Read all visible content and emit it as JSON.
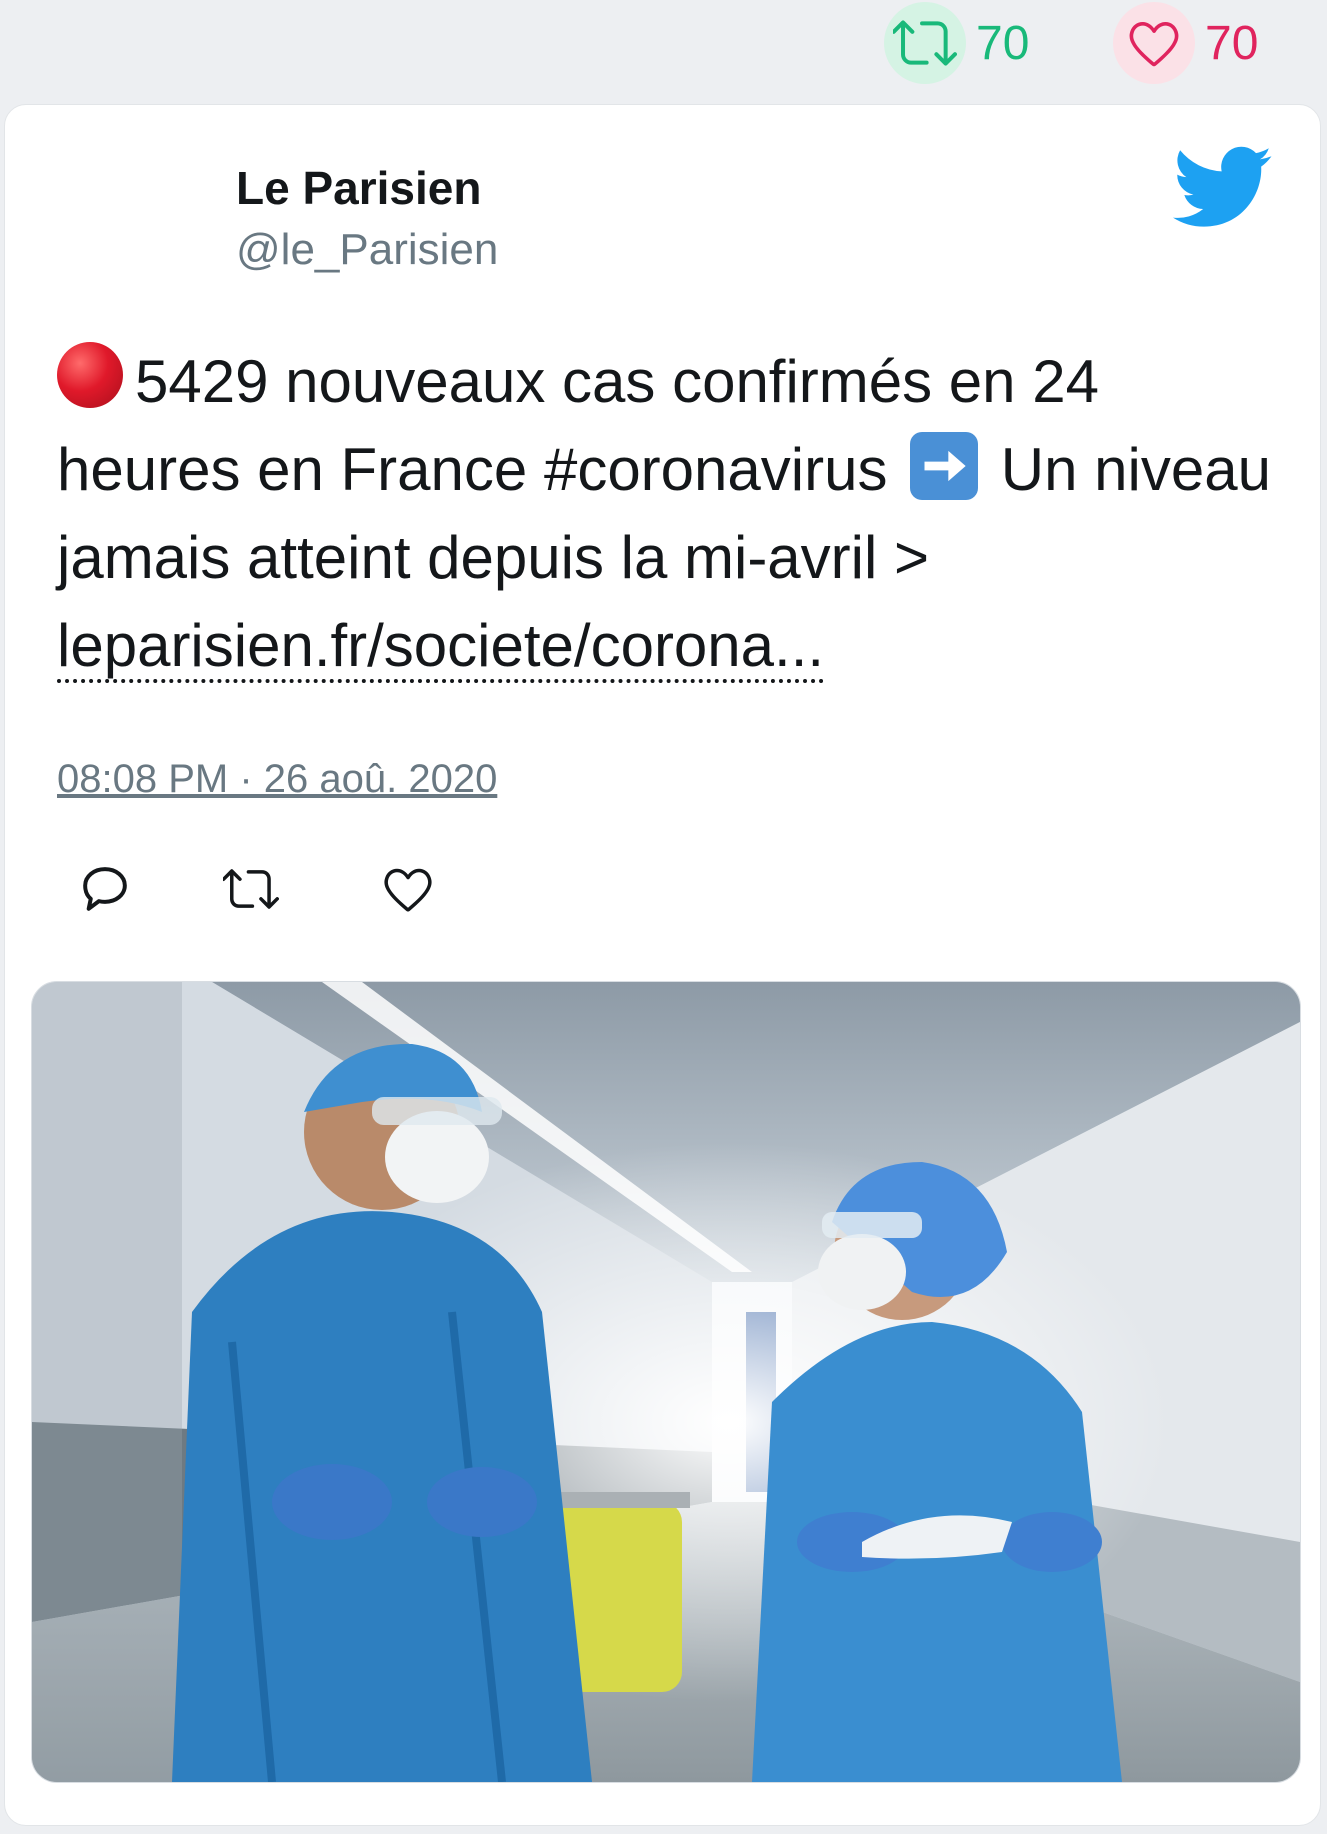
{
  "stats": {
    "retweets": "70",
    "likes": "70",
    "retweet_color": "#19b97a",
    "like_color": "#e0245e"
  },
  "tweet": {
    "author_name": "Le Parisien",
    "author_handle": "@le_Parisien",
    "text_part1": "5429 nouveaux cas confirmés en 24 heures en France #coronavirus",
    "text_part2": "Un niveau jamais atteint depuis la mi-avril >",
    "link_text": "leparisien.fr/societe/corona...",
    "timestamp": "08:08 PM · 26 aoû. 2020"
  },
  "icons": {
    "brand": "twitter-bird-icon",
    "emoji1": "red-circle-emoji",
    "emoji2": "right-arrow-emoji",
    "actions": [
      "reply-icon",
      "retweet-icon",
      "like-icon"
    ]
  },
  "colors": {
    "twitter_blue": "#1da1f2",
    "text": "#14171a",
    "secondary": "#697882"
  }
}
